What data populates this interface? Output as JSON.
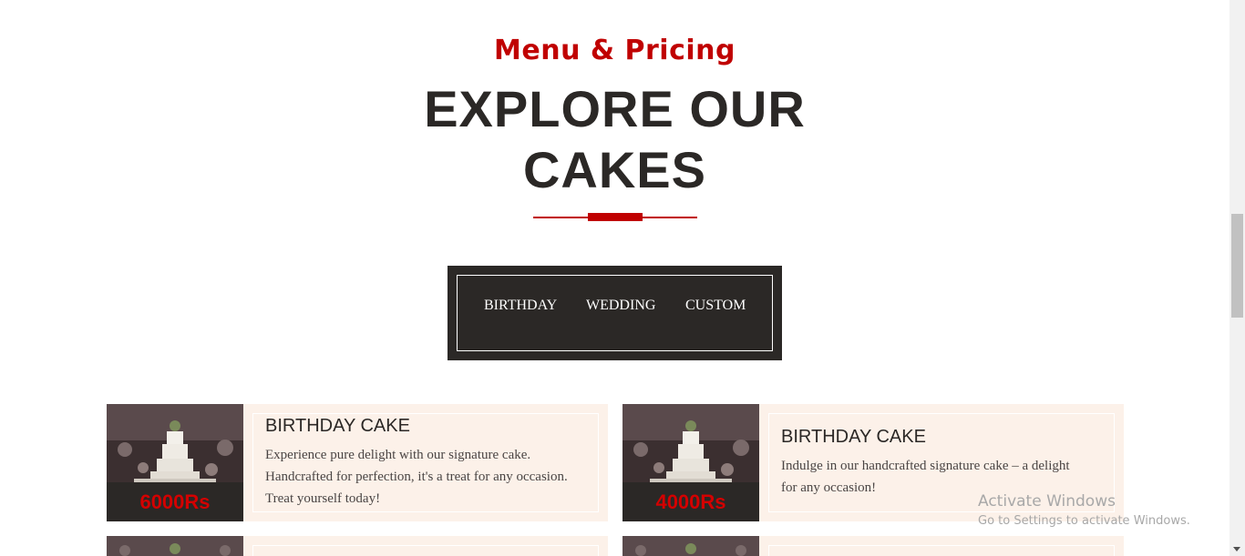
{
  "header": {
    "subtitle": "Menu & Pricing",
    "title_line1": "EXPLORE OUR",
    "title_line2": "CAKES"
  },
  "tabs": [
    {
      "label": "BIRTHDAY"
    },
    {
      "label": "WEDDING"
    },
    {
      "label": "CUSTOM"
    }
  ],
  "cards": [
    {
      "title": "BIRTHDAY CAKE",
      "price": "6000Rs",
      "description": "Experience pure delight with our signature cake. Handcrafted for perfection, it's a treat for any occasion. Treat yourself today!"
    },
    {
      "title": "BIRTHDAY CAKE",
      "price": "4000Rs",
      "description": "Indulge in our handcrafted signature cake – a delight for any occasion!"
    }
  ],
  "watermark": {
    "line1": "Activate Windows",
    "line2": "Go to Settings to activate Windows."
  },
  "colors": {
    "accent": "#c00000",
    "dark": "#2b2826",
    "card_bg": "#fcf1e9",
    "price": "#d40000"
  }
}
